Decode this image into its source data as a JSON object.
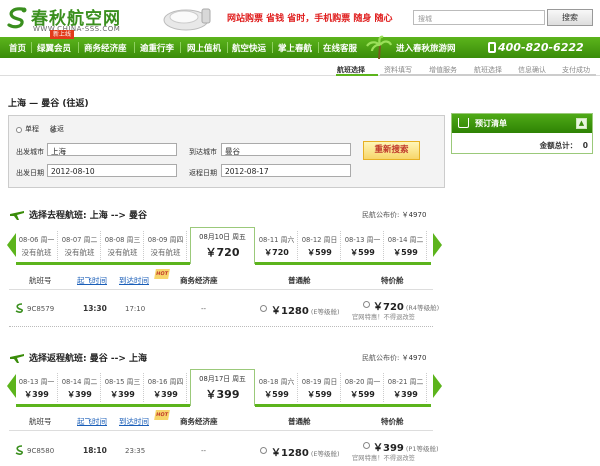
{
  "header": {
    "logo_cn": "春秋航空网",
    "logo_en": "WWW.CHINA-SSS.COM",
    "promo": "网站购票 省钱 省时，手机购票 随身 随心",
    "search_placeholder": "搜城",
    "search_button": "搜索"
  },
  "nav": {
    "items": [
      "首页",
      "绿翼会员",
      "商务经济座",
      "逾重行李",
      "网上值机",
      "航空快运",
      "掌上春航",
      "在线客服",
      "进入春秋旅游网"
    ],
    "new_badge": "新上线",
    "hotline": "400-820-6222"
  },
  "steps": [
    "航班选择",
    "资料填写",
    "增值服务",
    "航班选择",
    "信息确认",
    "支付成功"
  ],
  "route_title": "上海 — 曼谷 (往返)",
  "form": {
    "oneway_label": "单程",
    "return_label": "往返",
    "depart_city_label": "出发城市",
    "depart_city": "上海",
    "arrive_city_label": "到达城市",
    "arrive_city": "曼谷",
    "depart_date_label": "出发日期",
    "depart_date": "2012-08-10",
    "return_date_label": "返程日期",
    "return_date": "2012-08-17",
    "research_button": "重新搜索"
  },
  "booking": {
    "title": "预订清单",
    "total_label": "金额总计：",
    "total_value": "0"
  },
  "outbound": {
    "title": "选择去程航班: 上海 --> 曼谷",
    "public_fare_label": "民航公布价:",
    "public_fare": "￥4970",
    "dates": [
      {
        "date": "08-06 周一",
        "price": "没有航班"
      },
      {
        "date": "08-07 周二",
        "price": "没有航班"
      },
      {
        "date": "08-08 周三",
        "price": "没有航班"
      },
      {
        "date": "08-09 周四",
        "price": "没有航班"
      },
      {
        "date": "08月10日 周五",
        "price": "￥720"
      },
      {
        "date": "08-11 周六",
        "price": "￥720"
      },
      {
        "date": "08-12 周日",
        "price": "￥599"
      },
      {
        "date": "08-13 周一",
        "price": "￥599"
      },
      {
        "date": "08-14 周二",
        "price": "￥599"
      }
    ],
    "headers": {
      "flight": "航班号",
      "dep": "起飞时间",
      "arr": "到达时间",
      "business": "商务经济座",
      "hot": "HOT",
      "economy": "普通舱",
      "special": "特价舱"
    },
    "flight": {
      "no": "9C8579",
      "dep": "13:30",
      "arr": "17:10",
      "business": "--",
      "economy_price": "￥1280",
      "economy_class": "(E等级舱)",
      "special_price": "￥720",
      "special_class": "(R4等级舱)",
      "note": "官网特惠！不得退改签"
    }
  },
  "inbound": {
    "title": "选择返程航班: 曼谷 --> 上海",
    "public_fare_label": "民航公布价:",
    "public_fare": "￥4970",
    "dates": [
      {
        "date": "08-13 周一",
        "price": "￥399"
      },
      {
        "date": "08-14 周二",
        "price": "￥399"
      },
      {
        "date": "08-15 周三",
        "price": "￥399"
      },
      {
        "date": "08-16 周四",
        "price": "￥399"
      },
      {
        "date": "08月17日 周五",
        "price": "￥399"
      },
      {
        "date": "08-18 周六",
        "price": "￥599"
      },
      {
        "date": "08-19 周日",
        "price": "￥599"
      },
      {
        "date": "08-20 周一",
        "price": "￥599"
      },
      {
        "date": "08-21 周二",
        "price": "￥399"
      }
    ],
    "headers": {
      "flight": "航班号",
      "dep": "起飞时间",
      "arr": "到达时间",
      "business": "商务经济座",
      "hot": "HOT",
      "economy": "普通舱",
      "special": "特价舱"
    },
    "flight": {
      "no": "9C8580",
      "dep": "18:10",
      "arr": "23:35",
      "business": "--",
      "economy_price": "￥1280",
      "economy_class": "(E等级舱)",
      "special_price": "￥399",
      "special_class": "(P1等级舱)",
      "note": "官网特惠！不得退改签"
    }
  },
  "colors": {
    "brand_green": "#3a8c0a",
    "accent_red": "#e02020",
    "link_blue": "#1a5eb8"
  }
}
